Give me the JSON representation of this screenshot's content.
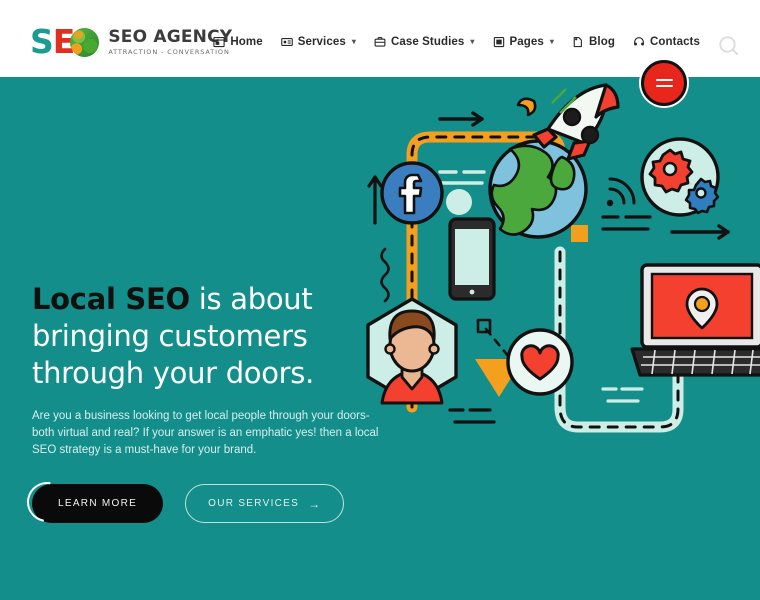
{
  "page": {
    "background_color": "#138e8a",
    "artifact_text": ");"
  },
  "header": {
    "background_color": "#ffffff",
    "logo": {
      "letter_s": "S",
      "letter_e": "E",
      "globe_icon": "globe-icon",
      "brand_name": "SEO AGENCY",
      "tagline": "ATTRACTION - CONVERSATION",
      "color_s": "#1a9c92",
      "color_e": "#e03020"
    },
    "nav_items": [
      {
        "label": "Home",
        "icon": "window-icon",
        "has_caret": false
      },
      {
        "label": "Services",
        "icon": "id-card-icon",
        "has_caret": true
      },
      {
        "label": "Case Studies",
        "icon": "briefcase-icon",
        "has_caret": true
      },
      {
        "label": "Pages",
        "icon": "page-icon",
        "has_caret": true
      },
      {
        "label": "Blog",
        "icon": "note-icon",
        "has_caret": false
      },
      {
        "label": "Contacts",
        "icon": "headset-icon",
        "has_caret": false
      }
    ],
    "caret_glyph": "▾",
    "search_icon": "search-icon",
    "menu_toggle": {
      "icon": "menu-toggle-icon",
      "color": "#e8261c"
    }
  },
  "hero": {
    "headline_accent": "Local SEO",
    "headline_rest": " is about bringing customers through your doors.",
    "paragraph": "Are you a business looking to get local people through your doors-both virtual and real? If your answer is an emphatic yes! then a local SEO strategy is a must-have for your brand.",
    "primary_button": {
      "label": "LEARN MORE",
      "spinner": "loading-spinner-icon"
    },
    "secondary_button": {
      "label": "OUR SERVICES",
      "arrow_glyph": "→"
    },
    "illustration": {
      "name": "seo-marketing-illustration",
      "elements": [
        "rocket-icon",
        "globe-icon",
        "facebook-icon",
        "smartphone-icon",
        "person-avatar-icon",
        "heart-icon",
        "laptop-map-pin-icon",
        "gears-icon",
        "wifi-signal-icon",
        "arrow-right-icon",
        "arrow-up-icon",
        "triangle-icon",
        "orange-square-icon"
      ],
      "colors": {
        "orange": "#f4a01e",
        "red": "#f4402f",
        "blue": "#3b7ec0",
        "mint": "#cdeee6",
        "green": "#4aa83c",
        "dark": "#111111"
      }
    }
  }
}
